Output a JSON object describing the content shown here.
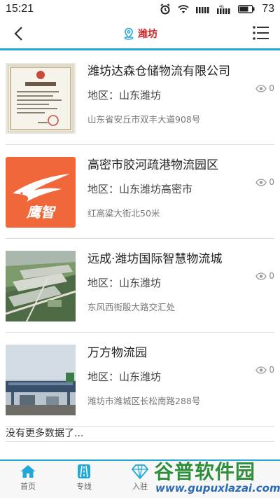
{
  "status_bar": {
    "time": "15:21",
    "battery_level": "73"
  },
  "header": {
    "location_title": "潍坊"
  },
  "items": [
    {
      "title": "潍坊达森仓储物流有限公司",
      "region_prefix": "地区：",
      "region": "山东潍坊",
      "address": "山东省安丘市双丰大道908号",
      "views": "0",
      "thumb": "business-license-photo"
    },
    {
      "title": "高密市胶河疏港物流园区",
      "region_prefix": "地区：",
      "region": "山东潍坊高密市",
      "address": "红高粱大街北50米",
      "views": "0",
      "thumb": "eagle-logo",
      "thumb_text": "鹰智"
    },
    {
      "title": "远成·潍坊国际智慧物流城",
      "region_prefix": "地区：",
      "region": "山东潍坊",
      "address": "东风西街殷大路交汇处",
      "views": "0",
      "thumb": "aerial-rendering"
    },
    {
      "title": "万方物流园",
      "region_prefix": "地区：",
      "region": "山东潍坊",
      "address": "潍坊市潍城区长松南路288号",
      "views": "0",
      "thumb": "logistics-gate-photo"
    }
  ],
  "no_more_text": "没有更多数据了...",
  "bottom_nav": [
    {
      "label": "首页",
      "icon": "home-icon"
    },
    {
      "label": "专线",
      "icon": "road-icon"
    },
    {
      "label": "入驻",
      "icon": "diamond-icon"
    }
  ],
  "watermark": {
    "logo": "谷普软件园",
    "url": "www.gupuxlazai.com"
  },
  "colors": {
    "accent": "#22a8d8",
    "title_red": "#d32020",
    "eagle_orange": "#f0683a"
  }
}
